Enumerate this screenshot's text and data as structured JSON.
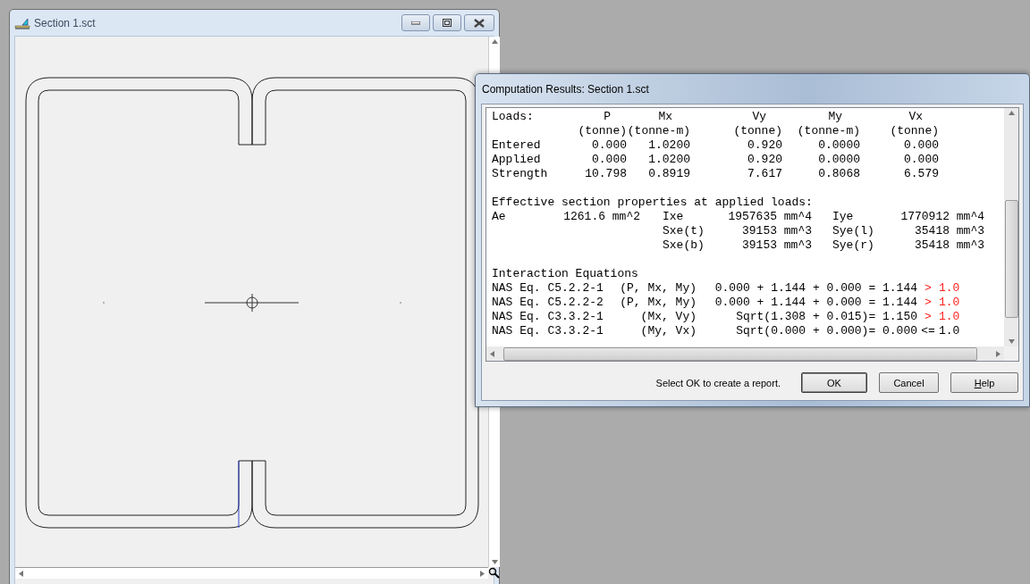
{
  "section_window": {
    "title": "Section 1.sct"
  },
  "dialog": {
    "title": "Computation Results: Section 1.sct",
    "loads": {
      "title": "Loads:",
      "columns": [
        {
          "name": "P",
          "unit": "(tonne)"
        },
        {
          "name": "Mx",
          "unit": "(tonne-m)"
        },
        {
          "name": "Vy",
          "unit": "(tonne)"
        },
        {
          "name": "My",
          "unit": "(tonne-m)"
        },
        {
          "name": "Vx",
          "unit": "(tonne)"
        }
      ],
      "rows": [
        {
          "label": "Entered",
          "values": [
            "0.000",
            "1.0200",
            "0.920",
            "0.0000",
            "0.000"
          ]
        },
        {
          "label": "Applied",
          "values": [
            "0.000",
            "1.0200",
            "0.920",
            "0.0000",
            "0.000"
          ]
        },
        {
          "label": "Strength",
          "values": [
            "10.798",
            "0.8919",
            "7.617",
            "0.8068",
            "6.579"
          ]
        }
      ]
    },
    "effective_properties": {
      "title": "Effective section properties at applied loads:",
      "column_1": [
        {
          "label": "Ae",
          "value": "1261.6 mm^2"
        }
      ],
      "column_2": [
        {
          "label": "Ixe",
          "value": "1957635 mm^4"
        },
        {
          "label": "Sxe(t)",
          "value": "39153 mm^3"
        },
        {
          "label": "Sxe(b)",
          "value": "39153 mm^3"
        }
      ],
      "column_3": [
        {
          "label": "Iye",
          "value": "1770912 mm^4"
        },
        {
          "label": "Sye(l)",
          "value": "35418 mm^3"
        },
        {
          "label": "Sye(r)",
          "value": "35418 mm^3"
        }
      ]
    },
    "interaction": {
      "title": "Interaction Equations",
      "rows": [
        {
          "equation": "NAS Eq. C5.2.2-1",
          "variables": "(P, Mx, My)",
          "expression": "0.000 + 1.144 + 0.000 = 1.144",
          "operator": ">",
          "limit": "1.0",
          "exceeded": true
        },
        {
          "equation": "NAS Eq. C5.2.2-2",
          "variables": "(P, Mx, My)",
          "expression": "0.000 + 1.144 + 0.000 = 1.144",
          "operator": ">",
          "limit": "1.0",
          "exceeded": true
        },
        {
          "equation": "NAS Eq. C3.3.2-1",
          "variables": "(Mx, Vy)",
          "expression": "Sqrt(1.308 + 0.015)= 1.150",
          "operator": ">",
          "limit": "1.0",
          "exceeded": true
        },
        {
          "equation": "NAS Eq. C3.3.2-1",
          "variables": "(My, Vx)",
          "expression": "Sqrt(0.000 + 0.000)= 0.000",
          "operator": "<=",
          "limit": "1.0",
          "exceeded": false
        }
      ]
    },
    "message": "Select OK to create a report.",
    "buttons": [
      {
        "label": "OK",
        "default": true
      },
      {
        "label": "Cancel",
        "default": false
      },
      {
        "label": "Help",
        "default": false
      }
    ]
  }
}
